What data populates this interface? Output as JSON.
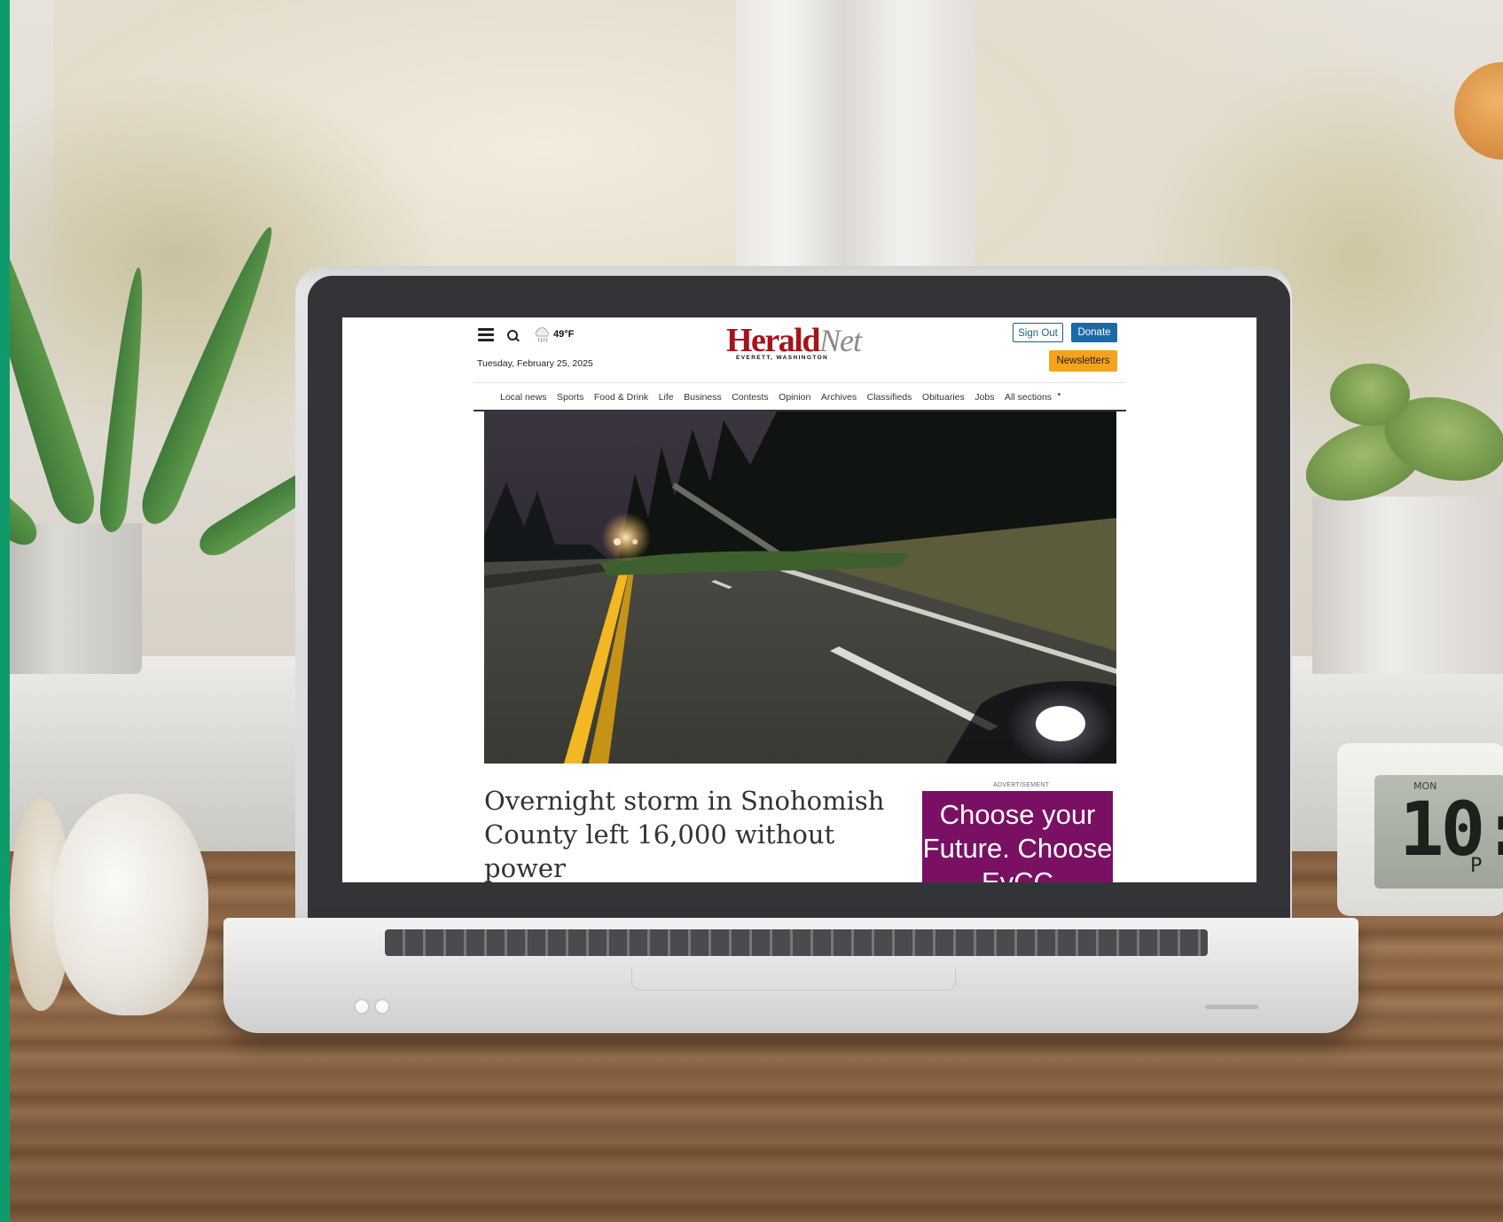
{
  "header": {
    "temperature": "49°F",
    "date": "Tuesday, February 25, 2025",
    "logo": {
      "herald": "Herald",
      "net": "Net",
      "location": "EVERETT, WASHINGTON"
    },
    "sign_out_label": "Sign Out",
    "donate_label": "Donate",
    "newsletters_label": "Newsletters"
  },
  "nav": {
    "items": [
      "Local news",
      "Sports",
      "Food & Drink",
      "Life",
      "Business",
      "Contests",
      "Opinion",
      "Archives",
      "Classifieds",
      "Obituaries",
      "Jobs",
      "All sections"
    ],
    "caret": "▾"
  },
  "article": {
    "headline": "Overnight storm in Snohomish County left 16,000 without power"
  },
  "ad": {
    "label": "ADVERTISEMENT",
    "text": "Choose your Future. Choose EvCC"
  },
  "clock": {
    "day": "MON",
    "time": "10:",
    "period": "P"
  },
  "colors": {
    "logo_red": "#a8121a",
    "donate_blue": "#1b6aa5",
    "newsletters_orange": "#f7a21b",
    "ad_purple": "#7a1064",
    "accent_green": "#0e9b6c"
  }
}
